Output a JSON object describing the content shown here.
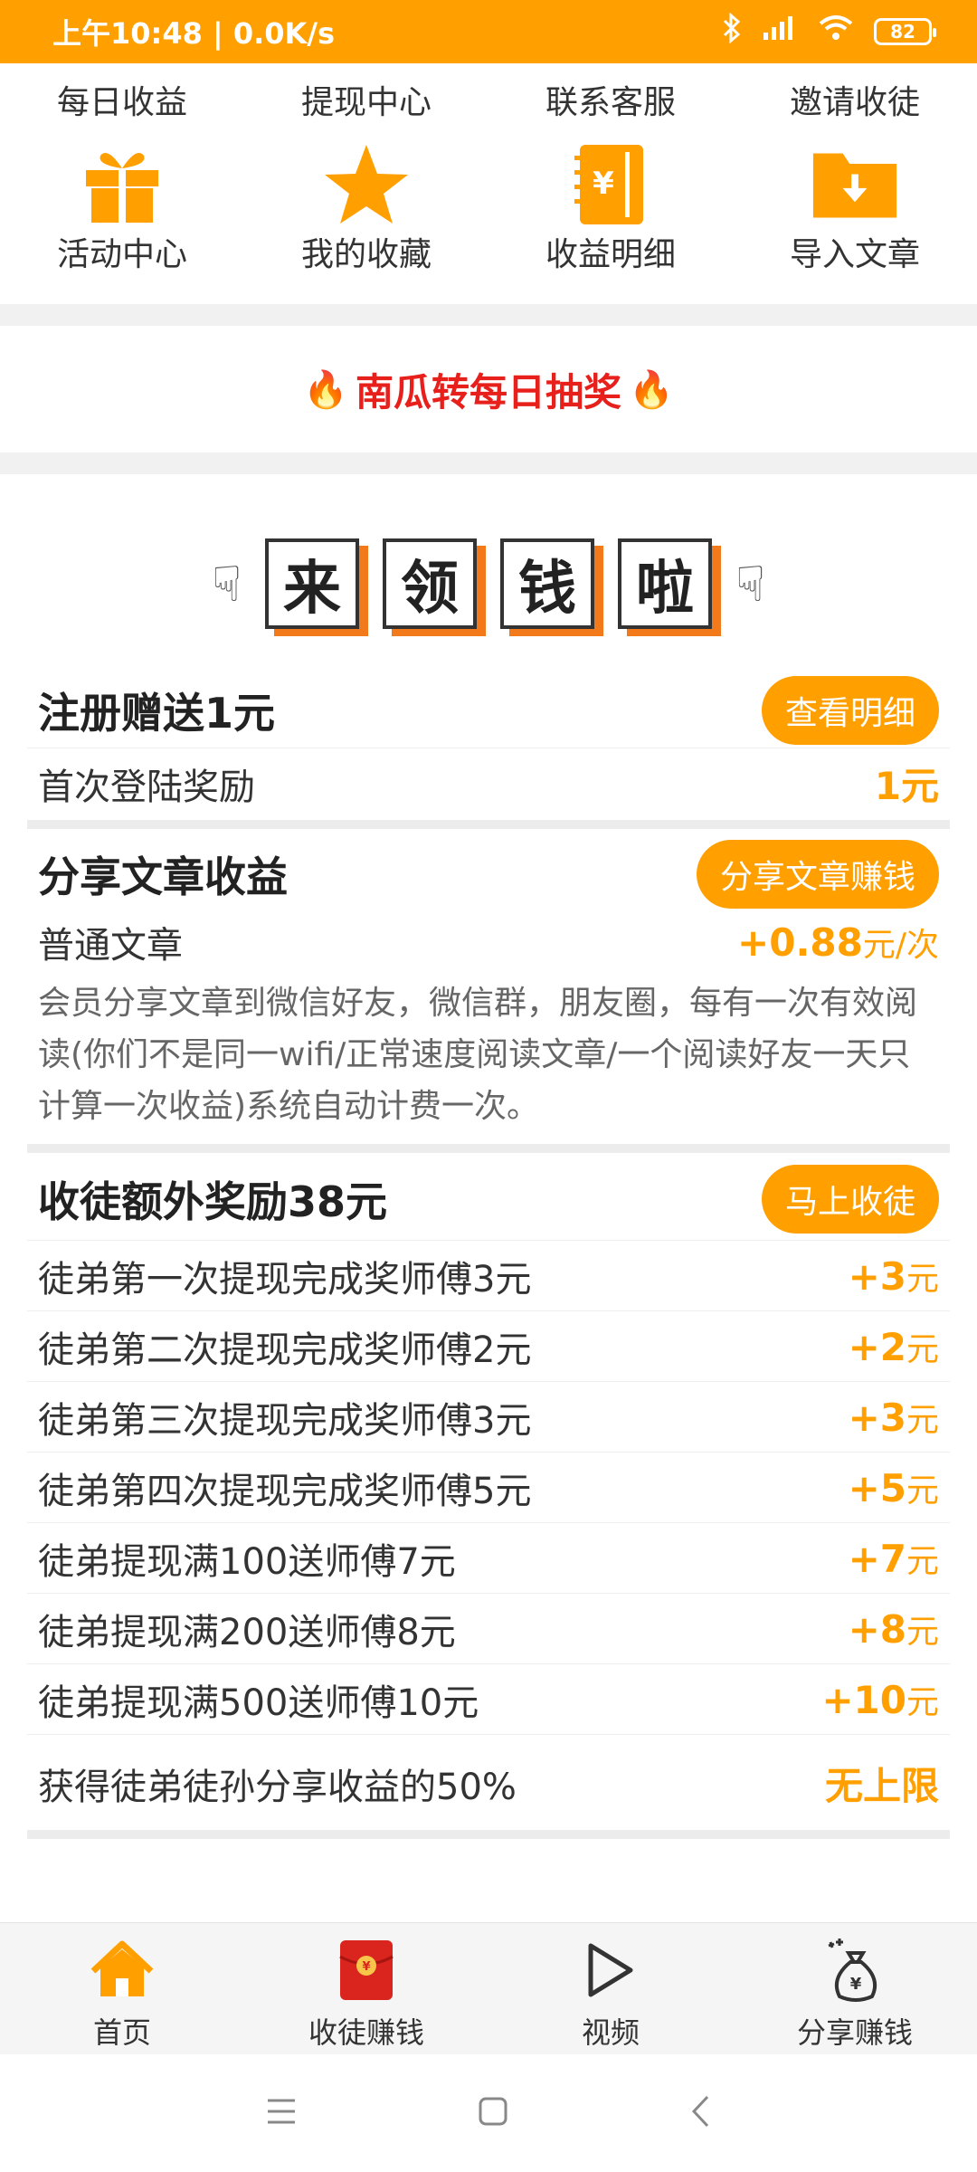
{
  "status": {
    "time": "上午10:48 | 0.0K/s",
    "battery": "82"
  },
  "menu_top": [
    {
      "label": "每日收益"
    },
    {
      "label": "提现中心"
    },
    {
      "label": "联系客服"
    },
    {
      "label": "邀请收徒"
    }
  ],
  "menu_bottom": [
    {
      "label": "活动中心",
      "icon": "gift-icon"
    },
    {
      "label": "我的收藏",
      "icon": "star-icon"
    },
    {
      "label": "收益明细",
      "icon": "ledger-icon"
    },
    {
      "label": "导入文章",
      "icon": "folder-download-icon"
    }
  ],
  "lottery": {
    "label": "南瓜转每日抽奖"
  },
  "banner": {
    "chars": [
      "来",
      "领",
      "钱",
      "啦"
    ]
  },
  "register": {
    "title": "注册赠送1元",
    "button": "查看明细",
    "item_label": "首次登陆奖励",
    "item_value": "1元"
  },
  "share": {
    "title": "分享文章收益",
    "button": "分享文章赚钱",
    "item_label": "普通文章",
    "item_value": "+0.88",
    "item_unit": "元/次",
    "description": "会员分享文章到微信好友，微信群，朋友圈，每有一次有效阅读(你们不是同一wifi/正常速度阅读文章/一个阅读好友一天只计算一次收益)系统自动计费一次。"
  },
  "apprentice": {
    "title": "收徒额外奖励38元",
    "button": "马上收徒",
    "rows": [
      {
        "label": "徒弟第一次提现完成奖师傅3元",
        "value": "+3",
        "unit": "元"
      },
      {
        "label": "徒弟第二次提现完成奖师傅2元",
        "value": "+2",
        "unit": "元"
      },
      {
        "label": "徒弟第三次提现完成奖师傅3元",
        "value": "+3",
        "unit": "元"
      },
      {
        "label": "徒弟第四次提现完成奖师傅5元",
        "value": "+5",
        "unit": "元"
      },
      {
        "label": "徒弟提现满100送师傅7元",
        "value": "+7",
        "unit": "元"
      },
      {
        "label": "徒弟提现满200送师傅8元",
        "value": "+8",
        "unit": "元"
      },
      {
        "label": "徒弟提现满500送师傅10元",
        "value": "+10",
        "unit": "元"
      }
    ],
    "footer_label": "获得徒弟徒孙分享收益的50%",
    "footer_value": "无上限"
  },
  "nav": [
    {
      "label": "首页",
      "icon": "home-icon",
      "color": "#FF9F00"
    },
    {
      "label": "收徒赚钱",
      "icon": "red-envelope-icon"
    },
    {
      "label": "视频",
      "icon": "play-icon"
    },
    {
      "label": "分享赚钱",
      "icon": "money-bag-icon"
    }
  ],
  "colors": {
    "accent": "#FF9F00",
    "lottery": "#e8201c",
    "banner_shadow": "#F27A1A"
  }
}
